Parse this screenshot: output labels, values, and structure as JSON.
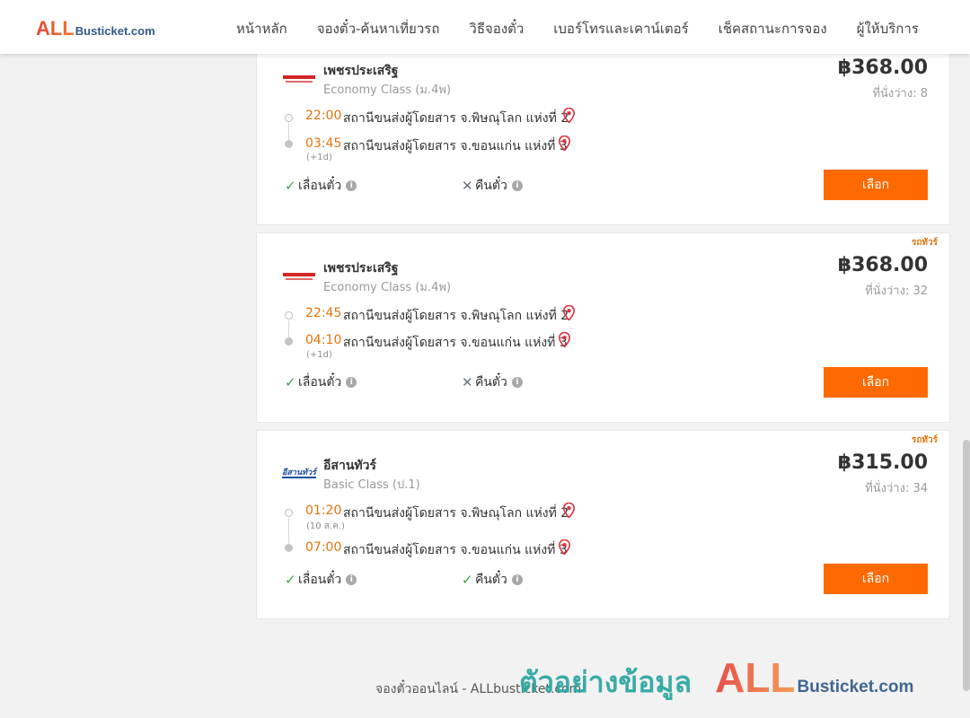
{
  "header": {
    "logo": {
      "all": "ALL",
      "rest": "Busticket.com"
    },
    "nav": [
      "หน้าหลัก",
      "จองตั๋ว-ค้นหาเที่ยวรถ",
      "วิธีจองตั๋ว",
      "เบอร์โทรและเคาน์เตอร์",
      "เช็คสถานะการจอง",
      "ผู้ให้บริการ"
    ]
  },
  "trips": [
    {
      "tag": "",
      "operator": "เพชรประเสริฐ",
      "operator_logo": "phetprasert-logo",
      "bus_class": "Economy Class (ม.4พ)",
      "price": "฿368.00",
      "seats": "ที่นั่งว่าง: 8",
      "depart_time": "22:00",
      "depart_station": "สถานีขนส่งผู้โดยสาร จ.พิษณุโลก แห่งที่ 2",
      "depart_note": "",
      "arrive_time": "03:45",
      "arrive_station": "สถานีขนส่งผู้โดยสาร จ.ขอนแก่น แห่งที่ 3",
      "arrive_note": "(+1d)",
      "reschedule_label": "เลื่อนตั๋ว",
      "reschedule_allowed": true,
      "refund_label": "คืนตั๋ว",
      "refund_allowed": false,
      "select_label": "เลือก"
    },
    {
      "tag": "รถทัวร์",
      "operator": "เพชรประเสริฐ",
      "operator_logo": "phetprasert-logo",
      "bus_class": "Economy Class (ม.4พ)",
      "price": "฿368.00",
      "seats": "ที่นั่งว่าง: 32",
      "depart_time": "22:45",
      "depart_station": "สถานีขนส่งผู้โดยสาร จ.พิษณุโลก แห่งที่ 2",
      "depart_note": "",
      "arrive_time": "04:10",
      "arrive_station": "สถานีขนส่งผู้โดยสาร จ.ขอนแก่น แห่งที่ 3",
      "arrive_note": "(+1d)",
      "reschedule_label": "เลื่อนตั๋ว",
      "reschedule_allowed": true,
      "refund_label": "คืนตั๋ว",
      "refund_allowed": false,
      "select_label": "เลือก"
    },
    {
      "tag": "รถทัวร์",
      "operator": "อีสานทัวร์",
      "operator_logo": "isantour-logo",
      "operator_logo_text": "อีสานทัวร์",
      "bus_class": "Basic Class (ป.1)",
      "price": "฿315.00",
      "seats": "ที่นั่งว่าง: 34",
      "depart_time": "01:20",
      "depart_station": "สถานีขนส่งผู้โดยสาร จ.พิษณุโลก แห่งที่ 2",
      "depart_note": "(10 ส.ค.)",
      "arrive_time": "07:00",
      "arrive_station": "สถานีขนส่งผู้โดยสาร จ.ขอนแก่น แห่งที่ 3",
      "arrive_note": "",
      "reschedule_label": "เลื่อนตั๋ว",
      "reschedule_allowed": true,
      "refund_label": "คืนตั๋ว",
      "refund_allowed": true,
      "select_label": "เลือก"
    }
  ],
  "footer": {
    "text": "จองตั๋วออนไลน์ - ALLbusticket.com"
  },
  "watermark": {
    "thai": "ตัวอย่างข้อมูล",
    "all": "ALL",
    "rest": "Busticket.com"
  },
  "colors": {
    "accent": "#ff6a00",
    "time": "#e8730c",
    "ok": "#3ba84a",
    "pin": "#e0303a"
  },
  "icons": {
    "pin": "map-pin-icon",
    "check": "check-icon",
    "cross": "cross-icon",
    "info": "info-icon"
  }
}
